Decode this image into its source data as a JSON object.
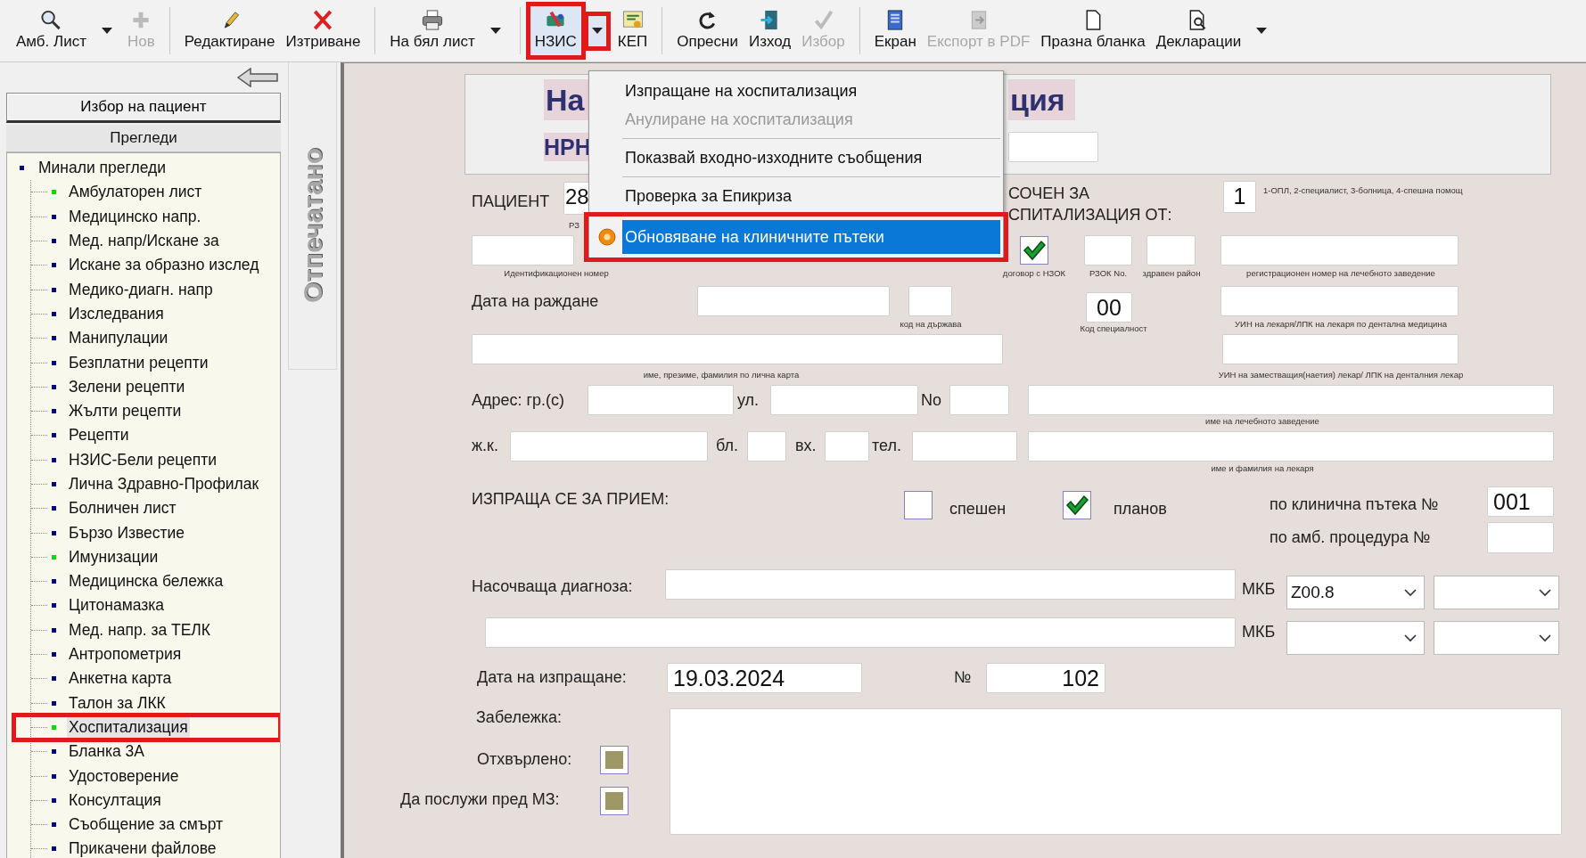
{
  "toolbar": [
    {
      "kind": "button",
      "label": "Амб. Лист",
      "disabled": false,
      "highlighted": false
    },
    {
      "kind": "dropdown",
      "disabled": false,
      "highlighted": false
    },
    {
      "kind": "button",
      "label": "Нов",
      "disabled": true,
      "highlighted": false
    },
    {
      "kind": "separator"
    },
    {
      "kind": "button",
      "label": "Редактиране",
      "disabled": false,
      "highlighted": false
    },
    {
      "kind": "button",
      "label": "Изтриване",
      "disabled": false,
      "highlighted": false
    },
    {
      "kind": "separator"
    },
    {
      "kind": "button",
      "label": "На бял лист",
      "disabled": false,
      "highlighted": false
    },
    {
      "kind": "dropdown",
      "disabled": false,
      "highlighted": false
    },
    {
      "kind": "separator"
    },
    {
      "kind": "button",
      "label": "НЗИС",
      "disabled": false,
      "highlighted": true
    },
    {
      "kind": "dropdown",
      "disabled": false,
      "highlighted": true
    },
    {
      "kind": "button",
      "label": "КЕП",
      "disabled": false,
      "highlighted": false
    },
    {
      "kind": "separator"
    },
    {
      "kind": "button",
      "label": "Опресни",
      "disabled": false,
      "highlighted": false
    },
    {
      "kind": "button",
      "label": "Изход",
      "disabled": false,
      "highlighted": false
    },
    {
      "kind": "button",
      "label": "Избор",
      "disabled": true,
      "highlighted": false
    },
    {
      "kind": "separator"
    },
    {
      "kind": "button",
      "label": "Екран",
      "disabled": false,
      "highlighted": false
    },
    {
      "kind": "button",
      "label": "Експорт в PDF",
      "disabled": true,
      "highlighted": false
    },
    {
      "kind": "button",
      "label": "Празна бланка",
      "disabled": false,
      "highlighted": false
    },
    {
      "kind": "button",
      "label": "Декларации",
      "disabled": false,
      "highlighted": false
    },
    {
      "kind": "dropdown",
      "disabled": false,
      "highlighted": false
    }
  ],
  "sidebar": {
    "select_patient_button": "Избор на пациент",
    "section_header": "Прегледи",
    "tree": [
      {
        "label": "Минали прегледи",
        "color": "#000080",
        "children": [
          {
            "label": "Амбулаторен лист",
            "color": "#00e000",
            "selected": false,
            "highlighted": false
          },
          {
            "label": "Медицинско напр.",
            "color": "#000080",
            "selected": false,
            "highlighted": false
          },
          {
            "label": "Мед. напр/Искане за",
            "color": "#000080",
            "selected": false,
            "highlighted": false
          },
          {
            "label": "Искане за образно изслед",
            "color": "#000080",
            "selected": false,
            "highlighted": false
          },
          {
            "label": "Медико-диагн. напр",
            "color": "#000080",
            "selected": false,
            "highlighted": false
          },
          {
            "label": "Изследвания",
            "color": "#000080",
            "selected": false,
            "highlighted": false
          },
          {
            "label": "Манипулации",
            "color": "#000080",
            "selected": false,
            "highlighted": false
          },
          {
            "label": "Безплатни рецепти",
            "color": "#000080",
            "selected": false,
            "highlighted": false
          },
          {
            "label": "Зелени рецепти",
            "color": "#000080",
            "selected": false,
            "highlighted": false
          },
          {
            "label": "Жълти рецепти",
            "color": "#000080",
            "selected": false,
            "highlighted": false
          },
          {
            "label": "Рецепти",
            "color": "#000080",
            "selected": false,
            "highlighted": false
          },
          {
            "label": "НЗИС-Бели рецепти",
            "color": "#000080",
            "selected": false,
            "highlighted": false
          },
          {
            "label": "Лична Здравно-Профилак",
            "color": "#000080",
            "selected": false,
            "highlighted": false
          },
          {
            "label": "Болничен лист",
            "color": "#000080",
            "selected": false,
            "highlighted": false
          },
          {
            "label": "Бързо Известие",
            "color": "#000080",
            "selected": false,
            "highlighted": false
          },
          {
            "label": "Имунизации",
            "color": "#00e000",
            "selected": false,
            "highlighted": false
          },
          {
            "label": "Медицинска бележка",
            "color": "#000080",
            "selected": false,
            "highlighted": false
          },
          {
            "label": "Цитонамазка",
            "color": "#000080",
            "selected": false,
            "highlighted": false
          },
          {
            "label": "Мед. напр. за ТЕЛК",
            "color": "#000080",
            "selected": false,
            "highlighted": false
          },
          {
            "label": "Антропометрия",
            "color": "#000080",
            "selected": false,
            "highlighted": false
          },
          {
            "label": "Анкетна карта",
            "color": "#000080",
            "selected": false,
            "highlighted": false
          },
          {
            "label": "Талон за ЛКК",
            "color": "#000080",
            "selected": false,
            "highlighted": false
          },
          {
            "label": "Хоспитализация",
            "color": "#00e000",
            "selected": true,
            "highlighted": true
          },
          {
            "label": "Бланка 3А",
            "color": "#000080",
            "selected": false,
            "highlighted": false
          },
          {
            "label": "Удостоверение",
            "color": "#000080",
            "selected": false,
            "highlighted": false
          },
          {
            "label": "Консултация",
            "color": "#000080",
            "selected": false,
            "highlighted": false
          },
          {
            "label": "Съобщение за смърт",
            "color": "#000080",
            "selected": false,
            "highlighted": false
          },
          {
            "label": "Прикачени файлове",
            "color": "#000080",
            "selected": false,
            "highlighted": false
          }
        ]
      }
    ]
  },
  "vertical_tab": {
    "label": "Отпечатано"
  },
  "form": {
    "title_start": "На",
    "title_end": "ция",
    "nrn_label": "НРН",
    "labels": [
      "ПАЦИЕНТ",
      "СОЧЕН ЗА",
      "СПИТАЛИЗАЦИЯ ОТ:",
      "Дата на раждане",
      "Адрес: гр.(с)",
      "ул.",
      "No",
      "ж.к.",
      "бл.",
      "вх.",
      "тел.",
      "ИЗПРАЩА СЕ ЗА ПРИЕМ:",
      "спешен",
      "планов",
      "по клинична пътека №",
      "по амб. процедура №",
      "Насочваща диагноза:",
      "МКБ",
      "МКБ",
      "Дата на изпращане:",
      "№",
      "Забележка:",
      "Отхвърлено:",
      "Да послужи пред МЗ:"
    ],
    "captions": [
      "РЗ",
      "1-ОПЛ, 2-специалист, 3-болница, 4-спешна помощ",
      "Идентификационен номер",
      "договор с НЗОК",
      "РЗОК No.",
      "здравен район",
      "регистрационен номер на лечебното заведение",
      "код на държава",
      "Код специалност",
      "УИН на лекаря/ЛПК на лекаря по дентална медицина",
      "име, презиме, фамилия по лична карта",
      "УИН на заместващия(наетия) лекар/ ЛПК на денталния лекар",
      "име на лечебното заведение",
      "име и фамилия на лекаря"
    ],
    "values": {
      "patient_number": "28",
      "referred_by": "1",
      "specialty_code": "00",
      "clinical_pathway": "001",
      "diagnosis_code": "Z00.8",
      "send_date": "19.03.2024",
      "number": "102"
    },
    "checkboxes": [
      {
        "checked": true,
        "disabled": false
      },
      {
        "checked": false,
        "disabled": false
      },
      {
        "checked": true,
        "disabled": false
      },
      {
        "checked": false,
        "disabled": true
      },
      {
        "checked": false,
        "disabled": true
      }
    ]
  },
  "menu": [
    {
      "kind": "item",
      "label": "Изпращане на хоспитализация",
      "disabled": false,
      "selected": false,
      "highlighted": false
    },
    {
      "kind": "item",
      "label": "Анулиране на хоспитализация",
      "disabled": true,
      "selected": false,
      "highlighted": false
    },
    {
      "kind": "separator"
    },
    {
      "kind": "item",
      "label": "Показвай входно-изходните съобщения",
      "disabled": false,
      "selected": false,
      "highlighted": false
    },
    {
      "kind": "separator"
    },
    {
      "kind": "item",
      "label": "Проверка за Епикриза",
      "disabled": false,
      "selected": false,
      "highlighted": false
    },
    {
      "kind": "separator"
    },
    {
      "kind": "item",
      "label": "Обновяване на клиничните пътеки",
      "disabled": false,
      "selected": true,
      "highlighted": true
    }
  ]
}
